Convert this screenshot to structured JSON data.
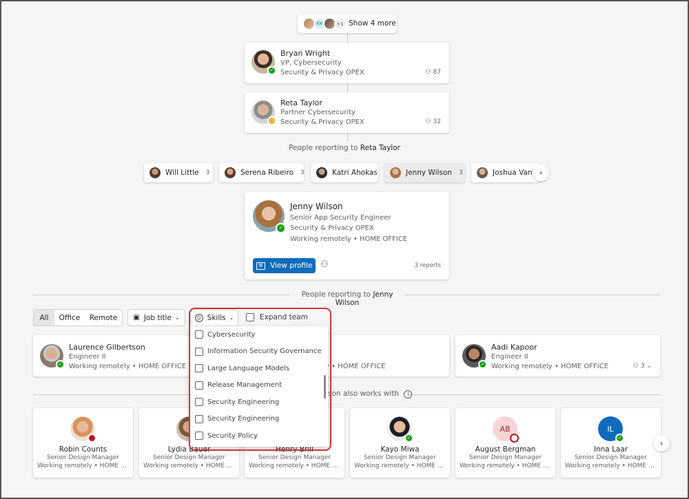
{
  "show_more": {
    "label": "Show 4 more",
    "avatars": [
      "",
      "KN",
      "",
      "+1"
    ]
  },
  "chain": [
    {
      "name": "Bryan Wright",
      "title": "VP, Cybersecurity",
      "dept": "Security & Privacy OPEX",
      "reports": "87",
      "presence": "available"
    },
    {
      "name": "Reta Taylor",
      "title": "Partner Cybersecurity",
      "dept": "Security & Privacy OPEX",
      "reports": "32",
      "presence": "away"
    }
  ],
  "reporting_to_manager": {
    "prefix": "People reporting to",
    "name": "Reta Taylor"
  },
  "peers": [
    {
      "name": "Will Little",
      "count": "3"
    },
    {
      "name": "Serena Ribeiro",
      "count": "3"
    },
    {
      "name": "Katri Ahokas",
      "count": ""
    },
    {
      "name": "Jenny Wilson",
      "count": "3"
    },
    {
      "name": "Joshua Vanb",
      "count": ""
    }
  ],
  "focus": {
    "name": "Jenny Wilson",
    "title": "Senior App Security Engineer",
    "dept": "Security & Privacy OPEX",
    "location": "Working remotely • HOME OFFICE",
    "view_profile": "View profile",
    "reports": "3 reports"
  },
  "reporting_to_focus": {
    "prefix": "People reporting to",
    "name": "Jenny Wilson"
  },
  "filters": {
    "segments": [
      "All",
      "Office",
      "Remote"
    ],
    "job_title": "Job title",
    "skills": "Skills",
    "expand_team": "Expand team"
  },
  "skills_options": [
    "Cybersecurity",
    "Information Security Governance",
    "Large Language Models",
    "Release Management",
    "Security Engineering",
    "Security Engineering",
    "Security Policy"
  ],
  "direct_reports": [
    {
      "name": "Laurence Gilbertson",
      "title": "Engineer II",
      "location": "Working remotely • HOME OFFICE"
    },
    {
      "name": "",
      "title": "",
      "location": "y • HOME OFFICE"
    },
    {
      "name": "Aadi Kapoor",
      "title": "Engineer II",
      "location": "Working remotely • HOME OFFICE",
      "reports": "3"
    }
  ],
  "works_with_label": "son also works with",
  "coworkers": [
    {
      "name": "Robin Counts",
      "title": "Senior Design Manager",
      "location": "Working remotely • HOME OFFI..."
    },
    {
      "name": "Lydia Bauer",
      "title": "Senior Design Manager",
      "location": "Working remotely • HOME OFFI..."
    },
    {
      "name": "Henry Brill",
      "title": "Senior Design Manager",
      "location": "Working remotely • HOME OFFI..."
    },
    {
      "name": "Kayo Miwa",
      "title": "Senior Design Manager",
      "location": "Working remotely • HOME OFFI..."
    },
    {
      "name": "August Bergman",
      "title": "Senior Design Manager",
      "location": "Working remotely • HOME OFFI...",
      "initials": "AB"
    },
    {
      "name": "Inna Laar",
      "title": "Senior Design Manager",
      "location": "Working remotely • HOME OFFI...",
      "initials": "IL"
    }
  ],
  "colors": {
    "accent": "#0f6cbd",
    "highlight_border": "#d13438",
    "available": "#13a10e",
    "away": "#eaa300",
    "busy": "#c50f1f"
  }
}
